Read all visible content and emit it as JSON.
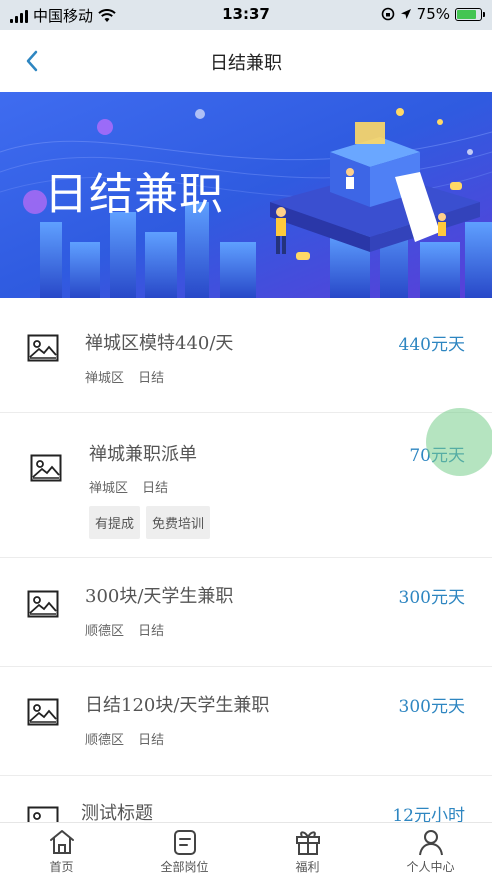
{
  "status_bar": {
    "carrier": "中国移动",
    "time": "13:37",
    "battery_percent": "75%"
  },
  "nav": {
    "title": "日结兼职"
  },
  "banner": {
    "text": "日结兼职"
  },
  "jobs": [
    {
      "title": "禅城区模特440/天",
      "district": "禅城区",
      "pay_type": "日结",
      "pay": "440元天",
      "tags": []
    },
    {
      "title": "禅城兼职派单",
      "district": "禅城区",
      "pay_type": "日结",
      "pay": "70元天",
      "tags": [
        "有提成",
        "免费培训"
      ]
    },
    {
      "title": "300块/天学生兼职",
      "district": "顺德区",
      "pay_type": "日结",
      "pay": "300元天",
      "tags": []
    },
    {
      "title": "日结120块/天学生兼职",
      "district": "顺德区",
      "pay_type": "日结",
      "pay": "300元天",
      "tags": []
    },
    {
      "title": "测试标题",
      "district": "",
      "pay_type": "",
      "pay": "12元小时",
      "tags": []
    }
  ],
  "tabbar": {
    "items": [
      {
        "label": "首页",
        "icon": "home-icon"
      },
      {
        "label": "全部岗位",
        "icon": "list-icon"
      },
      {
        "label": "福利",
        "icon": "gift-icon"
      },
      {
        "label": "个人中心",
        "icon": "user-icon"
      }
    ]
  },
  "colors": {
    "accent": "#2e86c1",
    "banner_bg": "#2f5be0"
  }
}
